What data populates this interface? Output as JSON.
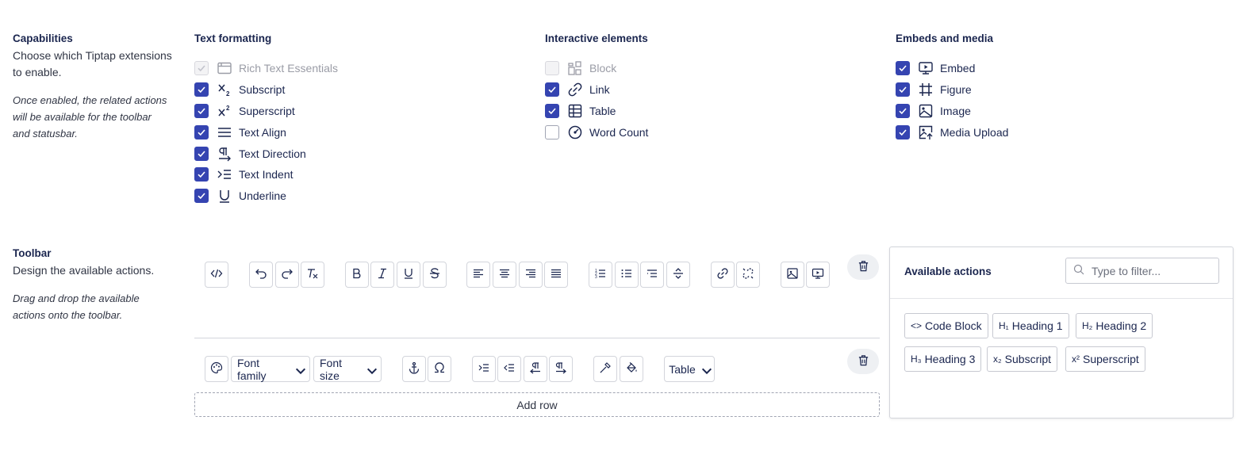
{
  "capabilities": {
    "title": "Capabilities",
    "description": "Choose which Tiptap extensions to enable.",
    "note": "Once enabled, the related actions will be available for the toolbar and statusbar.",
    "columns": [
      {
        "heading": "Text formatting",
        "items": [
          {
            "label": "Rich Text Essentials",
            "icon": "rich-text-essentials-icon",
            "checked": true,
            "disabled": true
          },
          {
            "label": "Subscript",
            "icon": "subscript-icon",
            "checked": true,
            "disabled": false
          },
          {
            "label": "Superscript",
            "icon": "superscript-icon",
            "checked": true,
            "disabled": false
          },
          {
            "label": "Text Align",
            "icon": "text-align-icon",
            "checked": true,
            "disabled": false
          },
          {
            "label": "Text Direction",
            "icon": "text-direction-icon",
            "checked": true,
            "disabled": false
          },
          {
            "label": "Text Indent",
            "icon": "text-indent-icon",
            "checked": true,
            "disabled": false
          },
          {
            "label": "Underline",
            "icon": "underline-icon",
            "checked": true,
            "disabled": false
          }
        ]
      },
      {
        "heading": "Interactive elements",
        "items": [
          {
            "label": "Block",
            "icon": "block-icon",
            "checked": false,
            "disabled": true
          },
          {
            "label": "Link",
            "icon": "link-icon",
            "checked": true,
            "disabled": false
          },
          {
            "label": "Table",
            "icon": "table-icon",
            "checked": true,
            "disabled": false
          },
          {
            "label": "Word Count",
            "icon": "word-count-icon",
            "checked": false,
            "disabled": false
          }
        ]
      },
      {
        "heading": "Embeds and media",
        "items": [
          {
            "label": "Embed",
            "icon": "embed-icon",
            "checked": true,
            "disabled": false
          },
          {
            "label": "Figure",
            "icon": "figure-icon",
            "checked": true,
            "disabled": false
          },
          {
            "label": "Image",
            "icon": "image-icon",
            "checked": true,
            "disabled": false
          },
          {
            "label": "Media Upload",
            "icon": "media-upload-icon",
            "checked": true,
            "disabled": false
          }
        ]
      }
    ]
  },
  "toolbar": {
    "title": "Toolbar",
    "description": "Design the available actions.",
    "note": "Drag and drop the available actions onto the toolbar.",
    "row1_icons": [
      "code-icon",
      "undo-icon",
      "redo-icon",
      "clear-formatting-icon",
      "bold-icon",
      "italic-icon",
      "underline-icon",
      "strikethrough-icon",
      "align-left-icon",
      "align-center-icon",
      "align-right-icon",
      "align-justify-icon",
      "ordered-list-icon",
      "bullet-list-icon",
      "list-indent-icon",
      "horizontal-rule-icon",
      "link-icon",
      "unlink-icon",
      "image-icon",
      "embed-icon"
    ],
    "row2": {
      "font_family": "Font family",
      "font_size": "Font size",
      "table": "Table",
      "icons": [
        "palette-icon",
        "anchor-icon",
        "special-character-icon",
        "indent-icon",
        "outdent-icon",
        "text-direction-rtl-icon",
        "text-direction-ltr-icon",
        "text-color-icon",
        "background-color-icon"
      ]
    },
    "add_row": "Add row",
    "delete_icon": "trash-icon"
  },
  "available_actions": {
    "title": "Available actions",
    "filter_placeholder": "Type to filter...",
    "items": [
      {
        "glyph": "<>",
        "label": "Code Block"
      },
      {
        "glyph": "H₁",
        "label": "Heading 1"
      },
      {
        "glyph": "H₂",
        "label": "Heading 2"
      },
      {
        "glyph": "H₃",
        "label": "Heading 3"
      },
      {
        "glyph": "x₂",
        "label": "Subscript"
      },
      {
        "glyph": "x²",
        "label": "Superscript"
      }
    ]
  },
  "colors": {
    "accent": "#3544b1",
    "text": "#1b264f"
  }
}
